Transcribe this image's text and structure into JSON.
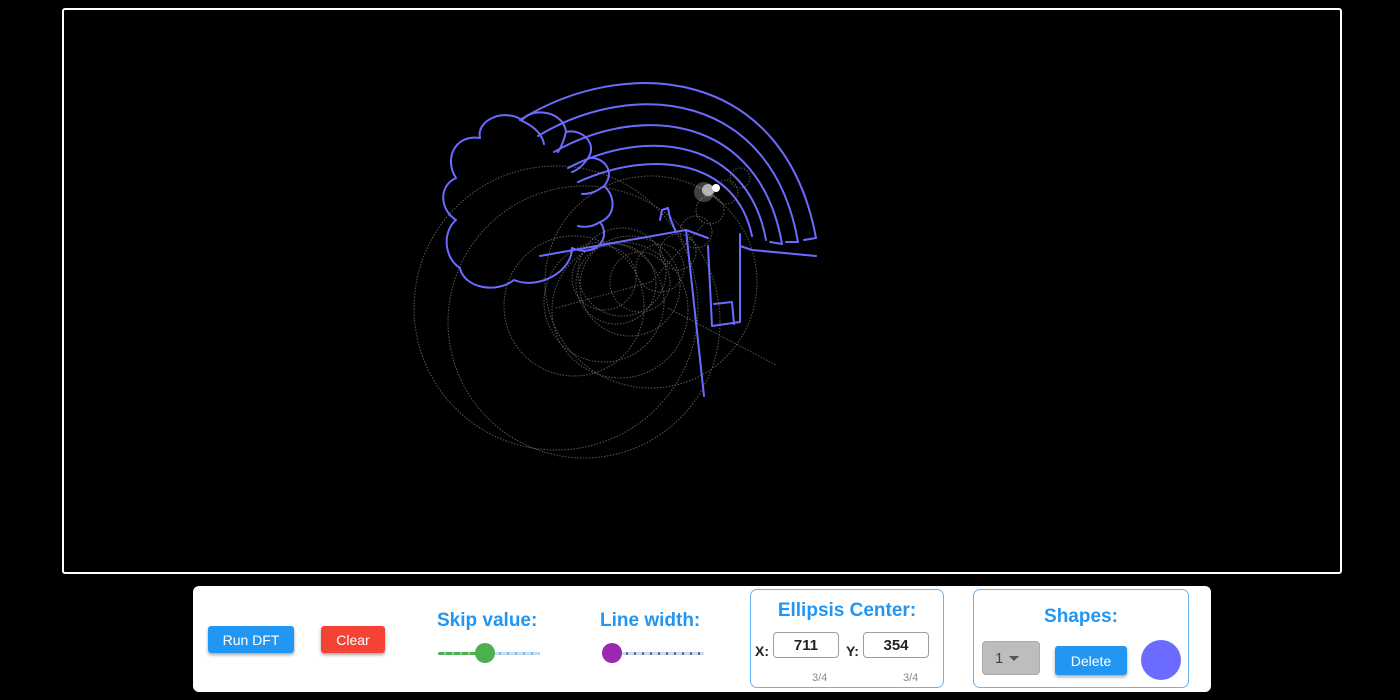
{
  "canvas": {
    "background": "#000000",
    "border_color": "#ffffff",
    "drawing_color": "#6b6bff",
    "epicycle_color": "#5a5a5a"
  },
  "controls": {
    "run_label": "Run DFT",
    "clear_label": "Clear",
    "skip_label": "Skip value:",
    "skip_level": 0.45,
    "width_label": "Line width:",
    "width_level": 0.0,
    "ellipse": {
      "title": "Ellipsis Center:",
      "x_label": "X:",
      "x_value": "711",
      "x_counter": "3/4",
      "y_label": "Y:",
      "y_value": "354",
      "y_counter": "3/4"
    },
    "shapes": {
      "title": "Shapes:",
      "selected": "1",
      "delete_label": "Delete",
      "color": "#6b6bff"
    },
    "colors": {
      "run": "#2196f3",
      "clear": "#f44336",
      "skip_slider": "#4caf50",
      "width_slider": "#9c27b0",
      "accent": "#2196f3"
    }
  }
}
